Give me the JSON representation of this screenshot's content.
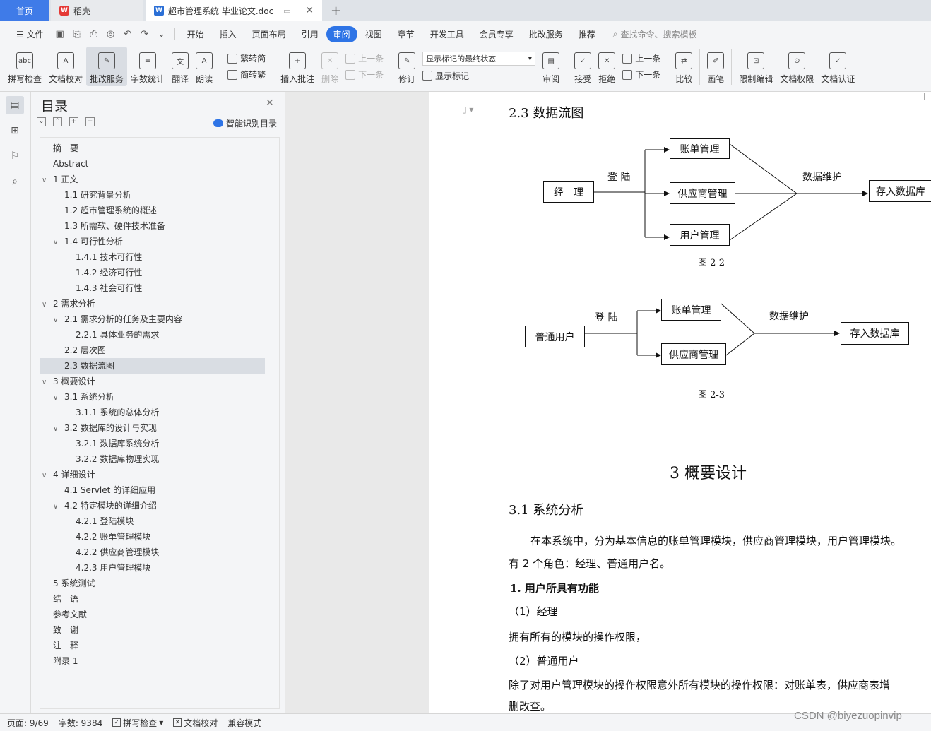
{
  "tabs": {
    "home": "首页",
    "app": "稻壳",
    "doc_title": "超市管理系统 毕业论文.doc"
  },
  "menu": {
    "file": "文件",
    "items": [
      "开始",
      "插入",
      "页面布局",
      "引用",
      "审阅",
      "视图",
      "章节",
      "开发工具",
      "会员专享",
      "批改服务",
      "推荐"
    ],
    "active": "审阅",
    "search": "查找命令、搜索模板"
  },
  "ribbon": {
    "spell": "拼写检查",
    "proofread": "文档校对",
    "review_service": "批改服务",
    "word_count": "字数统计",
    "translate": "翻译",
    "read_aloud": "朗读",
    "to_simplified": "繁转简",
    "to_traditional": "简转繁",
    "insert_comment": "插入批注",
    "delete": "删除",
    "prev": "上一条",
    "next": "下一条",
    "revise": "修订",
    "markup_state": "显示标记的最终状态",
    "show_markup": "显示标记",
    "review": "审阅",
    "accept": "接受",
    "reject": "拒绝",
    "prev2": "上一条",
    "next2": "下一条",
    "compare": "比较",
    "pen": "画笔",
    "restrict_edit": "限制编辑",
    "doc_permission": "文档权限",
    "doc_cert": "文档认证"
  },
  "toc": {
    "title": "目录",
    "smart": "智能识别目录",
    "items": [
      {
        "text": "摘　要",
        "level": 0,
        "chev": ""
      },
      {
        "text": "Abstract",
        "level": 0,
        "chev": ""
      },
      {
        "text": "1  正文",
        "level": 0,
        "chev": "v"
      },
      {
        "text": "1.1 研究背景分析",
        "level": 1,
        "chev": ""
      },
      {
        "text": "1.2  超市管理系统的概述",
        "level": 1,
        "chev": ""
      },
      {
        "text": "1.3 所需软、硬件技术准备",
        "level": 1,
        "chev": ""
      },
      {
        "text": "1.4 可行性分析",
        "level": 1,
        "chev": "v"
      },
      {
        "text": "1.4.1  技术可行性",
        "level": 2,
        "chev": ""
      },
      {
        "text": "1.4.2  经济可行性",
        "level": 2,
        "chev": ""
      },
      {
        "text": "1.4.3  社会可行性",
        "level": 2,
        "chev": ""
      },
      {
        "text": "2  需求分析",
        "level": 0,
        "chev": "v"
      },
      {
        "text": "2.1  需求分析的任务及主要内容",
        "level": 1,
        "chev": "v"
      },
      {
        "text": "2.2.1  具体业务的需求",
        "level": 2,
        "chev": ""
      },
      {
        "text": "2.2  层次图",
        "level": 1,
        "chev": ""
      },
      {
        "text": "2.3 数据流图",
        "level": 1,
        "chev": "",
        "active": true
      },
      {
        "text": "3  概要设计",
        "level": 0,
        "chev": "v"
      },
      {
        "text": "3.1    系统分析",
        "level": 1,
        "chev": "v"
      },
      {
        "text": "3.1.1  系统的总体分析",
        "level": 2,
        "chev": ""
      },
      {
        "text": "3.2  数据库的设计与实现",
        "level": 1,
        "chev": "v"
      },
      {
        "text": "3.2.1  数据库系统分析",
        "level": 2,
        "chev": ""
      },
      {
        "text": "3.2.2  数据库物理实现",
        "level": 2,
        "chev": ""
      },
      {
        "text": "4  详细设计",
        "level": 0,
        "chev": "v"
      },
      {
        "text": "4.1 Servlet 的详细应用",
        "level": 1,
        "chev": ""
      },
      {
        "text": "4.2  特定模块的详细介绍",
        "level": 1,
        "chev": "v"
      },
      {
        "text": "4.2.1  登陆模块",
        "level": 2,
        "chev": ""
      },
      {
        "text": "4.2.2  账单管理模块",
        "level": 2,
        "chev": ""
      },
      {
        "text": "4.2.2  供应商管理模块",
        "level": 2,
        "chev": ""
      },
      {
        "text": "4.2.3  用户管理模块",
        "level": 2,
        "chev": ""
      },
      {
        "text": "5  系统测试",
        "level": 0,
        "chev": ""
      },
      {
        "text": "结　语",
        "level": 0,
        "chev": ""
      },
      {
        "text": "参考文献",
        "level": 0,
        "chev": ""
      },
      {
        "text": "致　谢",
        "level": 0,
        "chev": ""
      },
      {
        "text": "注　释",
        "level": 0,
        "chev": ""
      },
      {
        "text": "附录 1",
        "level": 0,
        "chev": ""
      }
    ]
  },
  "document": {
    "heading_23": "2.3 数据流图",
    "d1": {
      "manager": "经　理",
      "login": "登 陆",
      "bill": "账单管理",
      "supplier": "供应商管理",
      "user": "用户管理",
      "maintain": "数据维护",
      "db": "存入数据库",
      "caption": "图 2-2"
    },
    "d2": {
      "user": "普通用户",
      "login": "登 陆",
      "bill": "账单管理",
      "supplier": "供应商管理",
      "maintain": "数据维护",
      "db": "存入数据库",
      "caption": "图 2-3"
    },
    "chapter3": "3  概要设计",
    "sec31": "3.1    系统分析",
    "para1": "在本系统中，分为基本信息的账单管理模块，供应商管理模块，用户管理模块。",
    "para2": "有 2 个角色：经理、普通用户名。",
    "bold1": "1.  用户所具有功能",
    "role1": "（1）经理",
    "para3": "拥有所有的模块的操作权限，",
    "role2": "（2）普通用户",
    "para4": "除了对用户管理模块的操作权限意外所有模块的操作权限：对账单表，供应商表增",
    "para5": "删改查。"
  },
  "status": {
    "page": "页面: 9/69",
    "words": "字数: 9384",
    "spell": "拼写检查",
    "proof": "文档校对",
    "compat": "兼容模式"
  },
  "watermark": "CSDN @biyezuopinvip"
}
